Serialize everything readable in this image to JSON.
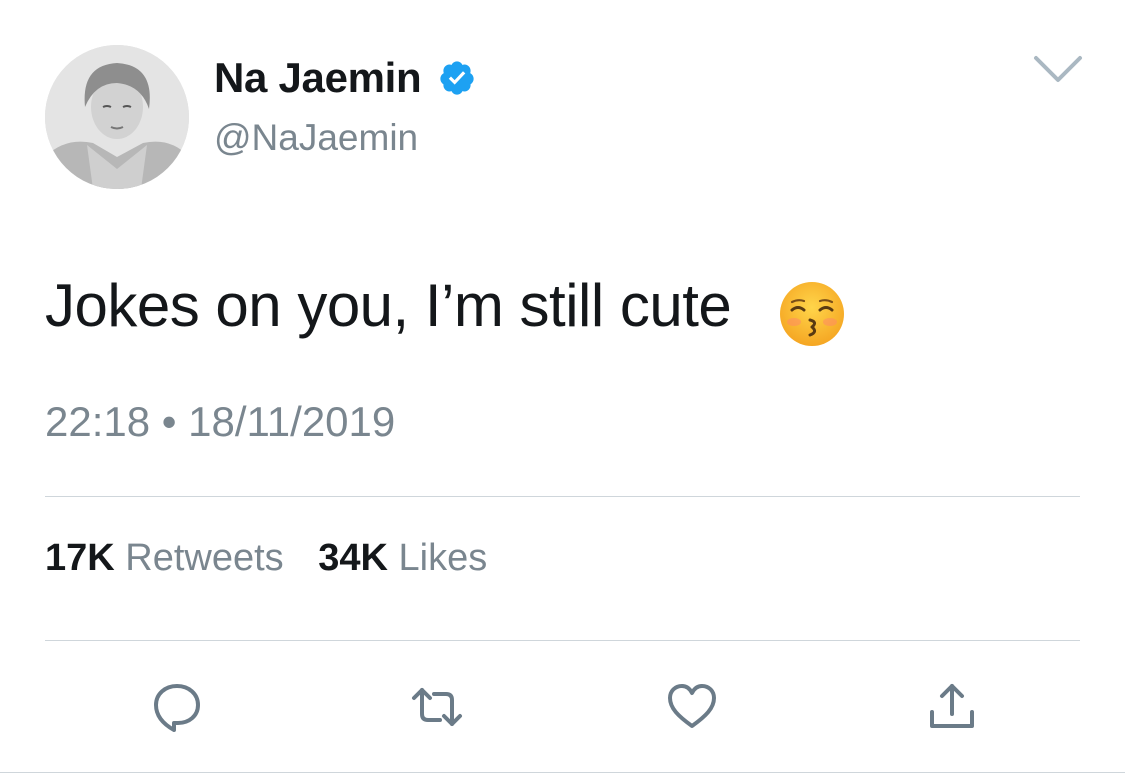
{
  "user": {
    "display_name": "Na Jaemin",
    "handle": "@NaJaemin",
    "verified": true,
    "avatar": "avatar-photo"
  },
  "tweet": {
    "text": "Jokes on you, I’m still cute",
    "emoji": "kissing-face-with-smiling-eyes"
  },
  "timestamp": {
    "time": "22:18",
    "separator": "•",
    "date": "18/11/2019"
  },
  "stats": {
    "retweets_count": "17K",
    "retweets_label": "Retweets",
    "likes_count": "34K",
    "likes_label": "Likes"
  },
  "actions": [
    "reply-icon",
    "retweet-icon",
    "like-icon",
    "share-icon"
  ],
  "colors": {
    "text": "#14171a",
    "secondary": "#7a868f",
    "verified": "#1da1f2",
    "divider": "#cfd6db"
  }
}
